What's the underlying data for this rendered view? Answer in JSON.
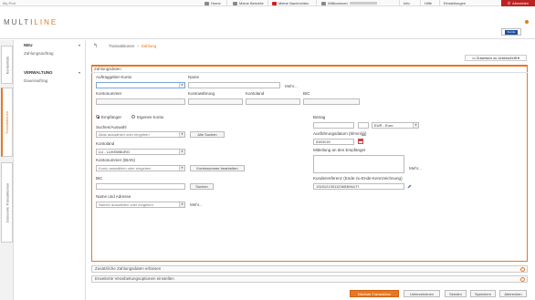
{
  "topbar": {
    "left_text": "My Prof",
    "nav": [
      {
        "icon": "home-icon",
        "label": "Home"
      },
      {
        "icon": "mail-icon",
        "label": "Meine Berichte"
      },
      {
        "icon": "message-icon",
        "label": "Meine Nachrichten"
      },
      {
        "icon": "user-icon",
        "label": "Willkommen"
      }
    ],
    "info": "Info",
    "hilfe": "Hilfe",
    "einstellungen": "Einstellungen",
    "abmelden": "Abmelden"
  },
  "logo": {
    "part1": "MULTI",
    "part2": "LINE"
  },
  "userbox": {
    "label": "Kunde"
  },
  "vtabs": [
    {
      "label": "Kontenliste"
    },
    {
      "label": "Transaktionen"
    },
    {
      "label": "Generelle Transaktionen"
    }
  ],
  "leftnav": {
    "section1": {
      "title": "NEU",
      "item": "Zahlungsauftrag"
    },
    "section2": {
      "title": "VERWALTUNG",
      "item": "Dauerauftrag"
    }
  },
  "breadcrumb": {
    "items": [
      "Transaktionen",
      "Zahlung"
    ]
  },
  "zuweisen_label": "Zuweisen zu Unterschrift",
  "form": {
    "title": "Zahlungsdaten",
    "auftraggeber_label": "Auftraggeber-Konto",
    "name_label": "Name",
    "mehr": "Mehr...",
    "kontonummer_label": "Kontonummer",
    "kontowaehrung_label": "Kontowährung",
    "kontoland_label": "Kontoland",
    "bic_label": "BIC",
    "radio_empfaenger": "Empfänger",
    "radio_eigenes": "Eigenes Konto",
    "suchen_auswahl_label": "Suchen/Auswahl",
    "suchen_placeholder": "Alias auswählen oder eingeben",
    "alle_suchen": "Alle Suchen",
    "kontoland2_label": "Kontoland",
    "kontoland2_value": "LU - LUXEMBURG",
    "kontonummer_iban_label": "Kontonummer (IBAN)",
    "iban_placeholder": "Konto auswählen oder eingeben",
    "kontonummer_bearbeiten": "Kontonummer bearbeiten",
    "bic2_label": "BIC",
    "bic_suchen": "Suchen",
    "name_adresse_label": "Name und Adresse",
    "name_placeholder": "Namen auswählen oder eingeben",
    "mehr2": "Mehr...",
    "betrag_label": "Betrag",
    "currency_value": "EUR - Euro",
    "ausfuehrung_label": "Ausführungsdatum (tt/mm/jjjj)",
    "date_value": "03/02/15",
    "mitteilung_label": "Mitteilung an den Empfänger",
    "mehr3": "Mehr...",
    "kundenreferenz_label": "Kundenreferenz (Ende-zu-Ende-Kennzeichnung)",
    "kundenreferenz_value": "1315121331123653MULTI"
  },
  "collapse": {
    "zusatz": "Zusätzliche Zahlungsdaten erfassen",
    "erweitert": "Erweiterte Verarbeitungsoptionen einstellen"
  },
  "footer": {
    "primary": "Nächste Transaktion",
    "unterzeichnen": "Unterzeichnen",
    "senden": "Senden",
    "speichern": "Speichern",
    "abbrechen": "Abbrechen"
  }
}
